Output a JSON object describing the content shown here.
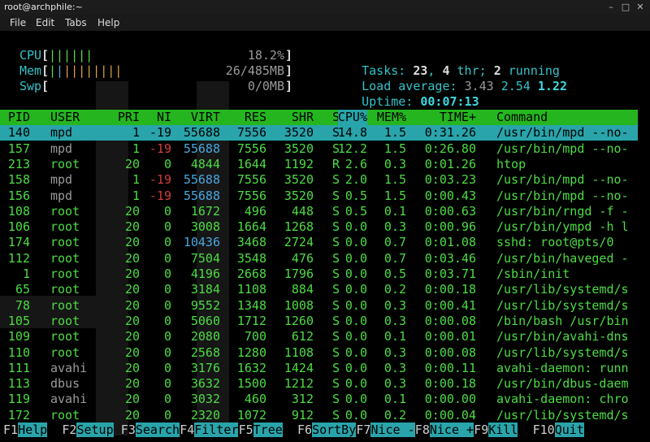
{
  "window": {
    "title": "root@archphile:~",
    "buttons": [
      "–",
      "□",
      "✕"
    ]
  },
  "menu": [
    "File",
    "Edit",
    "Tabs",
    "Help"
  ],
  "meters": {
    "cpu": {
      "label": "CPU",
      "bars": "||||||",
      "value": "18.2%"
    },
    "mem": {
      "label": "Mem",
      "bars": "||||||||||",
      "value": "26/485MB"
    },
    "swp": {
      "label": "Swp",
      "bars": "",
      "value": "0/0MB"
    }
  },
  "stats": {
    "tasks_label": "Tasks: ",
    "tasks": "23",
    "thr_sep": ", ",
    "thr": "4",
    "thr_label": " thr; ",
    "running": "2",
    "running_label": " running",
    "load_label": "Load average: ",
    "load1": "3.43",
    "load5": "2.54",
    "load15": "1.22",
    "uptime_label": "Uptime: ",
    "uptime": "00:07:13"
  },
  "columns": [
    "PID",
    "USER",
    "PRI",
    "NI",
    "VIRT",
    "RES",
    "SHR",
    "S",
    "CPU%",
    "MEM%",
    "TIME+",
    "Command"
  ],
  "sort_column": "CPU%",
  "selected_index": 0,
  "processes": [
    {
      "pid": "140",
      "user": "mpd",
      "pri": "1",
      "ni": "-19",
      "virt": "55688",
      "res": "7556",
      "shr": "3520",
      "s": "S",
      "cpu": "14.8",
      "mem": "1.5",
      "time": "0:31.26",
      "cmd": "/usr/bin/mpd --no-"
    },
    {
      "pid": "157",
      "user": "mpd",
      "pri": "1",
      "ni": "-19",
      "virt": "55688",
      "res": "7556",
      "shr": "3520",
      "s": "S",
      "cpu": "12.2",
      "mem": "1.5",
      "time": "0:26.80",
      "cmd": "/usr/bin/mpd --no-"
    },
    {
      "pid": "213",
      "user": "root",
      "pri": "20",
      "ni": "0",
      "virt": "4844",
      "res": "1644",
      "shr": "1192",
      "s": "R",
      "cpu": "2.6",
      "mem": "0.3",
      "time": "0:01.26",
      "cmd": "htop"
    },
    {
      "pid": "158",
      "user": "mpd",
      "pri": "1",
      "ni": "-19",
      "virt": "55688",
      "res": "7556",
      "shr": "3520",
      "s": "S",
      "cpu": "2.0",
      "mem": "1.5",
      "time": "0:03.23",
      "cmd": "/usr/bin/mpd --no-"
    },
    {
      "pid": "156",
      "user": "mpd",
      "pri": "1",
      "ni": "-19",
      "virt": "55688",
      "res": "7556",
      "shr": "3520",
      "s": "S",
      "cpu": "0.5",
      "mem": "1.5",
      "time": "0:00.43",
      "cmd": "/usr/bin/mpd --no-"
    },
    {
      "pid": "108",
      "user": "root",
      "pri": "20",
      "ni": "0",
      "virt": "1672",
      "res": "496",
      "shr": "448",
      "s": "S",
      "cpu": "0.5",
      "mem": "0.1",
      "time": "0:00.63",
      "cmd": "/usr/bin/rngd -f -"
    },
    {
      "pid": "106",
      "user": "root",
      "pri": "20",
      "ni": "0",
      "virt": "3008",
      "res": "1664",
      "shr": "1268",
      "s": "S",
      "cpu": "0.0",
      "mem": "0.3",
      "time": "0:00.96",
      "cmd": "/usr/bin/ympd -h l"
    },
    {
      "pid": "174",
      "user": "root",
      "pri": "20",
      "ni": "0",
      "virt": "10436",
      "res": "3468",
      "shr": "2724",
      "s": "S",
      "cpu": "0.0",
      "mem": "0.7",
      "time": "0:01.08",
      "cmd": "sshd: root@pts/0"
    },
    {
      "pid": "112",
      "user": "root",
      "pri": "20",
      "ni": "0",
      "virt": "7504",
      "res": "3548",
      "shr": "476",
      "s": "S",
      "cpu": "0.0",
      "mem": "0.7",
      "time": "0:03.46",
      "cmd": "/usr/bin/haveged -"
    },
    {
      "pid": "1",
      "user": "root",
      "pri": "20",
      "ni": "0",
      "virt": "4196",
      "res": "2668",
      "shr": "1796",
      "s": "S",
      "cpu": "0.0",
      "mem": "0.5",
      "time": "0:03.71",
      "cmd": "/sbin/init"
    },
    {
      "pid": "65",
      "user": "root",
      "pri": "20",
      "ni": "0",
      "virt": "3184",
      "res": "1108",
      "shr": "884",
      "s": "S",
      "cpu": "0.0",
      "mem": "0.2",
      "time": "0:00.18",
      "cmd": "/usr/lib/systemd/s"
    },
    {
      "pid": "78",
      "user": "root",
      "pri": "20",
      "ni": "0",
      "virt": "9552",
      "res": "1348",
      "shr": "1008",
      "s": "S",
      "cpu": "0.0",
      "mem": "0.3",
      "time": "0:00.41",
      "cmd": "/usr/lib/systemd/s"
    },
    {
      "pid": "105",
      "user": "root",
      "pri": "20",
      "ni": "0",
      "virt": "5060",
      "res": "1712",
      "shr": "1260",
      "s": "S",
      "cpu": "0.0",
      "mem": "0.3",
      "time": "0:00.08",
      "cmd": "/bin/bash /usr/bin"
    },
    {
      "pid": "109",
      "user": "root",
      "pri": "20",
      "ni": "0",
      "virt": "2080",
      "res": "700",
      "shr": "612",
      "s": "S",
      "cpu": "0.0",
      "mem": "0.1",
      "time": "0:00.01",
      "cmd": "/usr/bin/avahi-dns"
    },
    {
      "pid": "110",
      "user": "root",
      "pri": "20",
      "ni": "0",
      "virt": "2568",
      "res": "1280",
      "shr": "1108",
      "s": "S",
      "cpu": "0.0",
      "mem": "0.3",
      "time": "0:00.08",
      "cmd": "/usr/lib/systemd/s"
    },
    {
      "pid": "111",
      "user": "avahi",
      "pri": "20",
      "ni": "0",
      "virt": "3176",
      "res": "1632",
      "shr": "1424",
      "s": "S",
      "cpu": "0.0",
      "mem": "0.3",
      "time": "0:00.11",
      "cmd": "avahi-daemon: runn"
    },
    {
      "pid": "113",
      "user": "dbus",
      "pri": "20",
      "ni": "0",
      "virt": "3632",
      "res": "1500",
      "shr": "1212",
      "s": "S",
      "cpu": "0.0",
      "mem": "0.3",
      "time": "0:00.18",
      "cmd": "/usr/bin/dbus-daem"
    },
    {
      "pid": "119",
      "user": "avahi",
      "pri": "20",
      "ni": "0",
      "virt": "3032",
      "res": "460",
      "shr": "312",
      "s": "S",
      "cpu": "0.0",
      "mem": "0.1",
      "time": "0:00.00",
      "cmd": "avahi-daemon: chro"
    },
    {
      "pid": "172",
      "user": "root",
      "pri": "20",
      "ni": "0",
      "virt": "2320",
      "res": "1072",
      "shr": "912",
      "s": "S",
      "cpu": "0.0",
      "mem": "0.2",
      "time": "0:00.04",
      "cmd": "/usr/lib/systemd/s"
    }
  ],
  "fkeys": [
    {
      "key": "F1",
      "label": "Help"
    },
    {
      "key": "F2",
      "label": "Setup"
    },
    {
      "key": "F3",
      "label": "Search"
    },
    {
      "key": "F4",
      "label": "Filter"
    },
    {
      "key": "F5",
      "label": "Tree"
    },
    {
      "key": "F6",
      "label": "SortBy"
    },
    {
      "key": "F7",
      "label": "Nice -"
    },
    {
      "key": "F8",
      "label": "Nice +"
    },
    {
      "key": "F9",
      "label": "Kill"
    },
    {
      "key": "F10",
      "label": "Quit"
    }
  ]
}
